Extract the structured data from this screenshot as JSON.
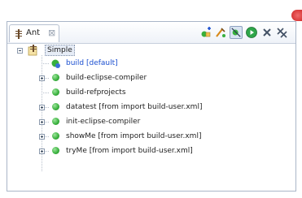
{
  "view": {
    "tab_label": "Ant",
    "tab_close": "⊠",
    "toolbar_icons": [
      "add-buildfiles-icon",
      "run-target-icon",
      "hide-internal-targets-icon",
      "run-icon",
      "remove-icon",
      "remove-all-icon"
    ]
  },
  "tree": {
    "project": "Simple",
    "items": [
      {
        "label": "build [default]",
        "expandable": false,
        "default": true
      },
      {
        "label": "build-eclipse-compiler",
        "expandable": true
      },
      {
        "label": "build-refprojects",
        "expandable": false
      },
      {
        "label": "datatest [from import build-user.xml]",
        "expandable": true
      },
      {
        "label": "init-eclipse-compiler",
        "expandable": true
      },
      {
        "label": "showMe [from import build-user.xml]",
        "expandable": true
      },
      {
        "label": "tryMe [from import build-user.xml]",
        "expandable": true
      }
    ]
  },
  "colors": {
    "default_target": "#1b4fd0",
    "accent": "#37b03c",
    "close": "#d83a3a"
  }
}
